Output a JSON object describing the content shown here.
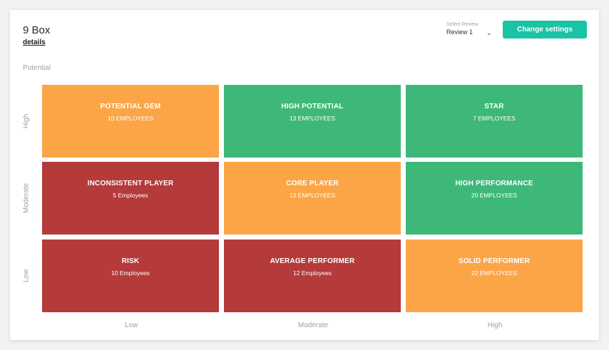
{
  "header": {
    "title": "9 Box",
    "details_link": "details",
    "review_select": {
      "caption": "Select Review",
      "value": "Review 1"
    },
    "change_settings_button": "Change settings"
  },
  "axes": {
    "y_title": "Potential",
    "y_labels": [
      "High",
      "Moderate",
      "Low"
    ],
    "x_labels": [
      "Low",
      "Moderate",
      "High"
    ]
  },
  "grid": [
    {
      "title": "POTENTIAL GEM",
      "count": "10 EMPLOYEES",
      "color": "#fca547"
    },
    {
      "title": "HIGH POTENTIAL",
      "count": "13 EMPLOYEES",
      "color": "#3db878"
    },
    {
      "title": "STAR",
      "count": "7 EMPLOYEES",
      "color": "#3db878"
    },
    {
      "title": "INCONSISTENT PLAYER",
      "count": "5 Employees",
      "color": "#b53a3a"
    },
    {
      "title": "CORE PLAYER",
      "count": "13 EMPLOYEES",
      "color": "#fca547"
    },
    {
      "title": "HIGH PERFORMANCE",
      "count": "20 EMPLOYEES",
      "color": "#3db878"
    },
    {
      "title": "RISK",
      "count": "10 Employees",
      "color": "#b53a3a"
    },
    {
      "title": "AVERAGE PERFORMER",
      "count": "12 Employees",
      "color": "#b53a3a"
    },
    {
      "title": "SOLID PERFORMER",
      "count": "22 EMPLOYEES",
      "color": "#fca547"
    }
  ],
  "icons": {
    "select_chevron": "chevron-down-icon"
  }
}
